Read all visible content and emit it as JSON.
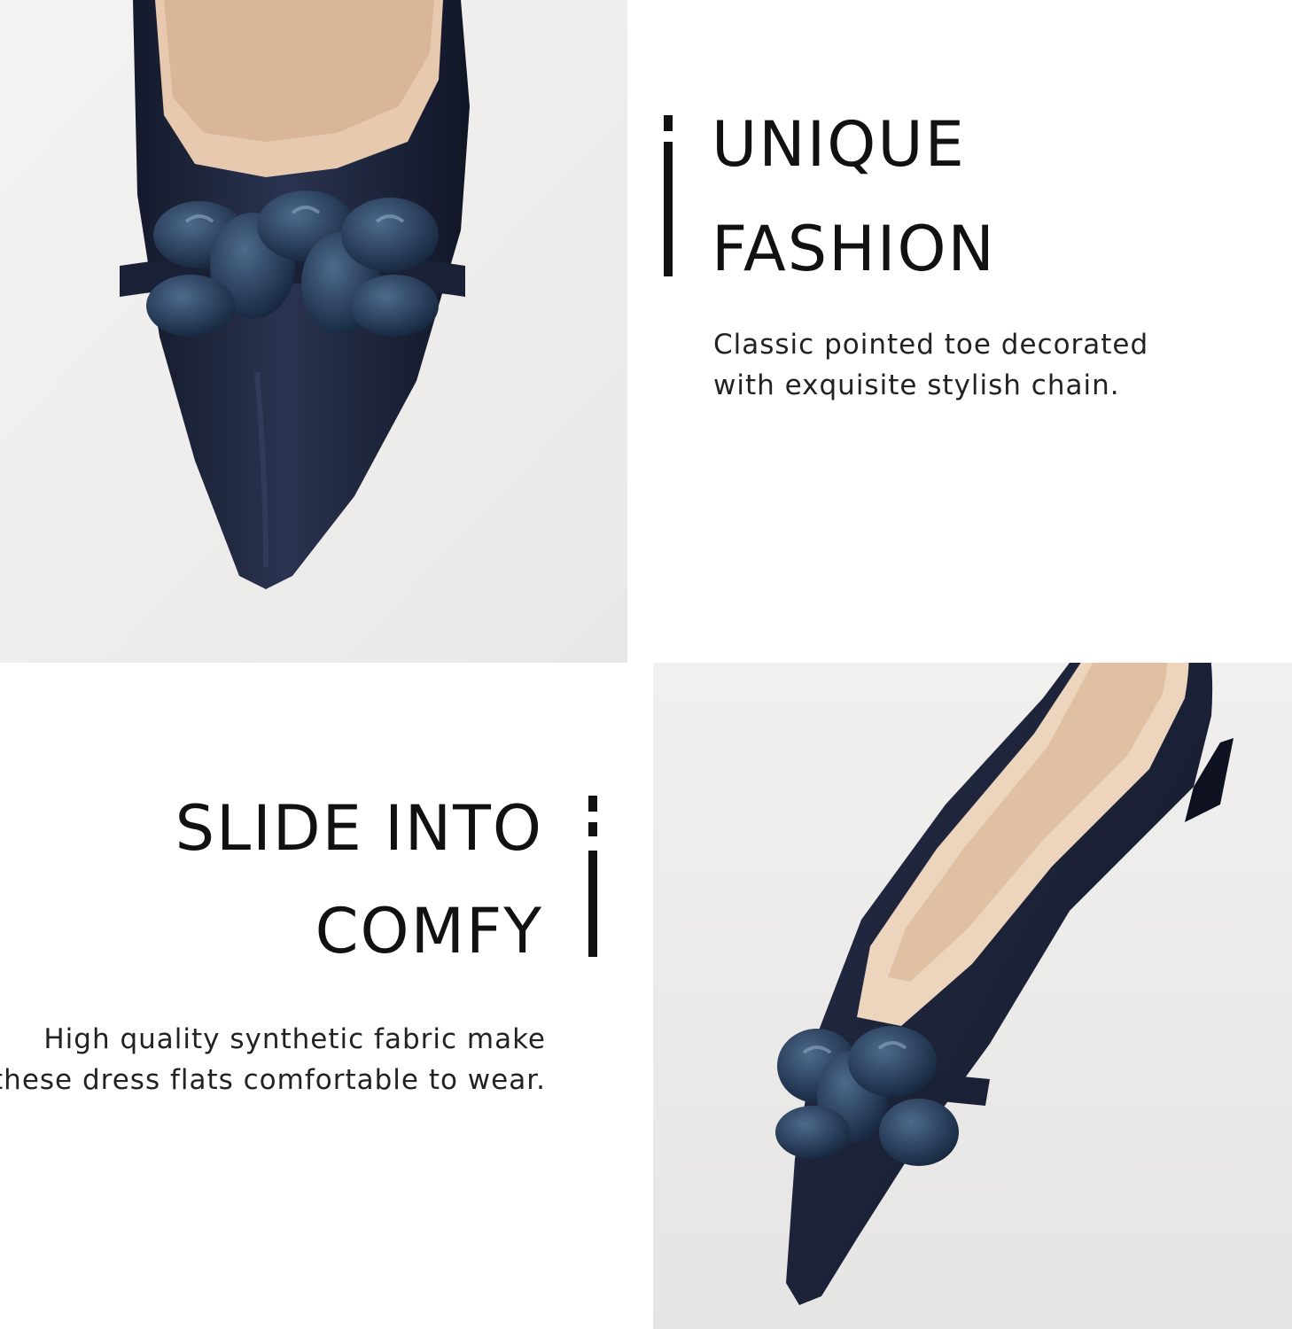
{
  "sections": {
    "unique": {
      "heading_line1": "UNIQUE",
      "heading_line2": "FASHION",
      "description_line1": "Classic pointed toe decorated",
      "description_line2": "with exquisite stylish chain."
    },
    "comfy": {
      "heading_line1": "SLIDE INTO",
      "heading_line2": "COMFY",
      "description_line1": "High quality synthetic fabric make",
      "description_line2": "these dress flats comfortable to wear."
    }
  },
  "colors": {
    "shoe": "#1b2338",
    "chain": "#1f3450",
    "lining": "#e8cdb5",
    "text": "#111111",
    "background": "#ffffff"
  },
  "icons": [
    "shoe-closeup-photo",
    "shoe-side-photo"
  ]
}
